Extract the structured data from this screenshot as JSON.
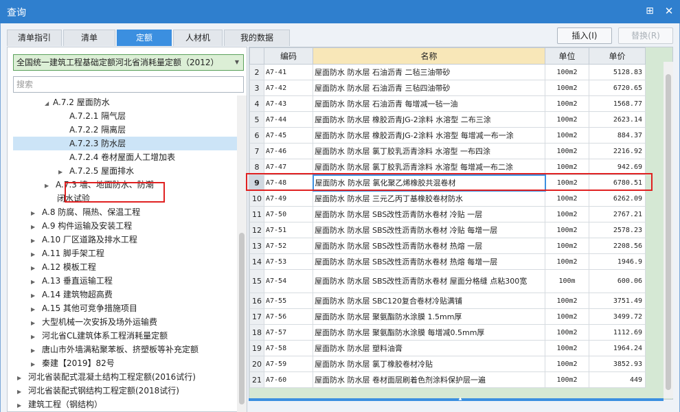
{
  "window": {
    "title": "查询",
    "pin_icon": "pin-icon",
    "close_icon": "close-icon"
  },
  "tabs": [
    {
      "label": "清单指引",
      "active": false
    },
    {
      "label": "清单",
      "active": false
    },
    {
      "label": "定额",
      "active": true
    },
    {
      "label": "人材机",
      "active": false
    },
    {
      "label": "我的数据",
      "active": false
    }
  ],
  "buttons": {
    "insert": "插入(I)",
    "replace": "替换(R)"
  },
  "left": {
    "quota_book": "全国统一建筑工程基础定额河北省消耗量定额（2012）",
    "search_placeholder": "搜索",
    "tree": [
      {
        "label": "A.7.2 屋面防水",
        "expander": "◢"
      },
      {
        "label": "A.7.2.1 隔气层",
        "expander": ""
      },
      {
        "label": "A.7.2.2 隔离层",
        "expander": ""
      },
      {
        "label": "A.7.2.3 防水层",
        "expander": ""
      },
      {
        "label": "A.7.2.4 卷材屋面人工增加表",
        "expander": ""
      },
      {
        "label": "A.7.2.5 屋面排水",
        "expander": "▶"
      },
      {
        "label": "A.7.3 墙、地面防水、防潮",
        "expander": "▶"
      },
      {
        "label": "闭水试验",
        "expander": ""
      },
      {
        "label": "A.8 防腐、隔热、保温工程",
        "expander": "▶"
      },
      {
        "label": "A.9 构件运输及安装工程",
        "expander": "▶"
      },
      {
        "label": "A.10 厂区道路及排水工程",
        "expander": "▶"
      },
      {
        "label": "A.11 脚手架工程",
        "expander": "▶"
      },
      {
        "label": "A.12 模板工程",
        "expander": "▶"
      },
      {
        "label": "A.13 垂直运输工程",
        "expander": "▶"
      },
      {
        "label": "A.14 建筑物超高费",
        "expander": "▶"
      },
      {
        "label": "A.15 其他可竞争措施项目",
        "expander": "▶"
      },
      {
        "label": "大型机械一次安拆及场外运输费",
        "expander": "▶"
      },
      {
        "label": "河北省CL建筑体系工程消耗量定额",
        "expander": "▶"
      },
      {
        "label": "唐山市外墙满粘聚苯板、挤塑板等补充定额",
        "expander": "▶"
      },
      {
        "label": "秦建【2019】82号",
        "expander": "▶"
      },
      {
        "label": "河北省装配式混凝土结构工程定额(2016试行)",
        "expander": "▶"
      },
      {
        "label": "河北省装配式钢结构工程定额(2018试行)",
        "expander": "▶"
      },
      {
        "label": "建筑工程（钢结构）",
        "expander": "▶"
      }
    ]
  },
  "grid": {
    "headers": {
      "idx": "",
      "code": "编码",
      "name": "名称",
      "unit": "单位",
      "price": "单价"
    },
    "rows": [
      {
        "idx": "2",
        "code": "A7-41",
        "name": "屋面防水 防水层 石油沥青 二毡三油带砂",
        "unit": "100m2",
        "price": "5128.83"
      },
      {
        "idx": "3",
        "code": "A7-42",
        "name": "屋面防水 防水层 石油沥青 三毡四油带砂",
        "unit": "100m2",
        "price": "6720.65"
      },
      {
        "idx": "4",
        "code": "A7-43",
        "name": "屋面防水 防水层 石油沥青 每增减一毡一油",
        "unit": "100m2",
        "price": "1568.77"
      },
      {
        "idx": "5",
        "code": "A7-44",
        "name": "屋面防水 防水层 橡胶沥青JG-2涂料 水溶型 二布三涂",
        "unit": "100m2",
        "price": "2623.14"
      },
      {
        "idx": "6",
        "code": "A7-45",
        "name": "屋面防水 防水层 橡胶沥青JG-2涂料 水溶型 每增减一布一涂",
        "unit": "100m2",
        "price": "884.37"
      },
      {
        "idx": "7",
        "code": "A7-46",
        "name": "屋面防水 防水层 氯丁胶乳沥青涂料 水溶型 一布四涂",
        "unit": "100m2",
        "price": "2216.92"
      },
      {
        "idx": "8",
        "code": "A7-47",
        "name": "屋面防水 防水层 氯丁胶乳沥青涂料 水溶型 每增减一布二涂",
        "unit": "100m2",
        "price": "942.69"
      },
      {
        "idx": "9",
        "code": "A7-48",
        "name": "屋面防水 防水层 氯化聚乙烯橡胶共混卷材",
        "unit": "100m2",
        "price": "6780.51"
      },
      {
        "idx": "10",
        "code": "A7-49",
        "name": "屋面防水 防水层 三元乙丙丁基橡胶卷材防水",
        "unit": "100m2",
        "price": "6262.09"
      },
      {
        "idx": "11",
        "code": "A7-50",
        "name": "屋面防水 防水层 SBS改性沥青防水卷材 冷贴 一层",
        "unit": "100m2",
        "price": "2767.21"
      },
      {
        "idx": "12",
        "code": "A7-51",
        "name": "屋面防水 防水层 SBS改性沥青防水卷材 冷贴 每增一层",
        "unit": "100m2",
        "price": "2578.23"
      },
      {
        "idx": "13",
        "code": "A7-52",
        "name": "屋面防水 防水层 SBS改性沥青防水卷材 热熔 一层",
        "unit": "100m2",
        "price": "2208.56"
      },
      {
        "idx": "14",
        "code": "A7-53",
        "name": "屋面防水 防水层 SBS改性沥青防水卷材 热熔 每增一层",
        "unit": "100m2",
        "price": "1946.9"
      },
      {
        "idx": "15",
        "code": "A7-54",
        "name": "屋面防水 防水层 SBS改性沥青防水卷材 屋面分格缝 点粘300宽",
        "unit": "100m",
        "price": "600.06"
      },
      {
        "idx": "16",
        "code": "A7-55",
        "name": "屋面防水 防水层 SBC120复合卷材冷贴满铺",
        "unit": "100m2",
        "price": "3751.49"
      },
      {
        "idx": "17",
        "code": "A7-56",
        "name": "屋面防水 防水层 聚氨酯防水涂膜 1.5mm厚",
        "unit": "100m2",
        "price": "3499.72"
      },
      {
        "idx": "18",
        "code": "A7-57",
        "name": "屋面防水 防水层 聚氨酯防水涂膜 每增减0.5mm厚",
        "unit": "100m2",
        "price": "1112.69"
      },
      {
        "idx": "19",
        "code": "A7-58",
        "name": "屋面防水 防水层 塑料油膏",
        "unit": "100m2",
        "price": "1964.24"
      },
      {
        "idx": "20",
        "code": "A7-59",
        "name": "屋面防水 防水层 氯丁橡胶卷材冷贴",
        "unit": "100m2",
        "price": "3852.93"
      },
      {
        "idx": "21",
        "code": "A7-60",
        "name": "屋面防水 防水层 卷材面层刷着色剂涂料保护层一遍",
        "unit": "100m2",
        "price": "449"
      }
    ]
  }
}
